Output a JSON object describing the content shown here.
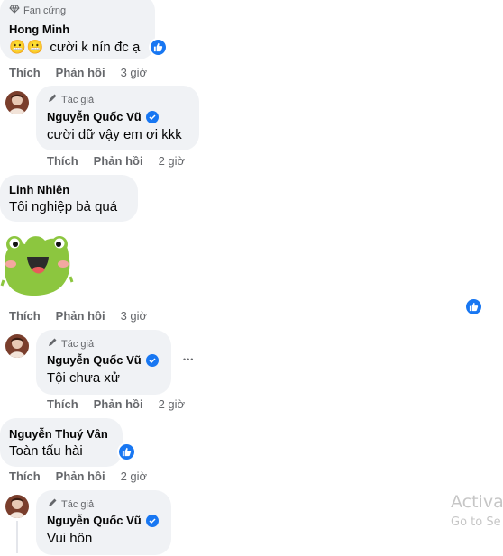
{
  "comments": [
    {
      "badge": "Fan cứng",
      "badge_icon": "diamond-icon",
      "author": "Hong Minh",
      "text": "cười k nín đc ạ",
      "emoji": [
        "😬",
        "😬"
      ],
      "reaction": "like-icon",
      "actions": {
        "like": "Thích",
        "reply": "Phản hồi",
        "time": "3 giờ"
      }
    },
    {
      "badge": "Tác giả",
      "badge_icon": "pencil-icon",
      "author": "Nguyễn Quốc Vũ",
      "verified": true,
      "text": "cười dữ vậy em ơi kkk",
      "actions": {
        "like": "Thích",
        "reply": "Phản hồi",
        "time": "2 giờ"
      }
    },
    {
      "author": "Linh Nhiên",
      "text": "Tôi nghiệp bả quá",
      "sticker": "frog-sticker-icon",
      "reaction": "like-icon",
      "actions": {
        "like": "Thích",
        "reply": "Phản hồi",
        "time": "3 giờ"
      }
    },
    {
      "badge": "Tác giả",
      "badge_icon": "pencil-icon",
      "author": "Nguyễn Quốc Vũ",
      "verified": true,
      "text": "Tội chưa xử",
      "more": "•••",
      "actions": {
        "like": "Thích",
        "reply": "Phản hồi",
        "time": "2 giờ"
      }
    },
    {
      "author": "Nguyễn Thuý Vân",
      "text": "Toàn tấu hài",
      "reaction": "like-icon",
      "actions": {
        "like": "Thích",
        "reply": "Phản hồi",
        "time": "2 giờ"
      }
    },
    {
      "badge": "Tác giả",
      "badge_icon": "pencil-icon",
      "author": "Nguyễn Quốc Vũ",
      "verified": true,
      "text": "Vui hôn"
    }
  ],
  "watermark": {
    "line1": "Activat",
    "line2": "Go to Se"
  },
  "colors": {
    "bubble": "#f0f2f5",
    "secondary": "#65676b",
    "accent": "#1877f2"
  }
}
